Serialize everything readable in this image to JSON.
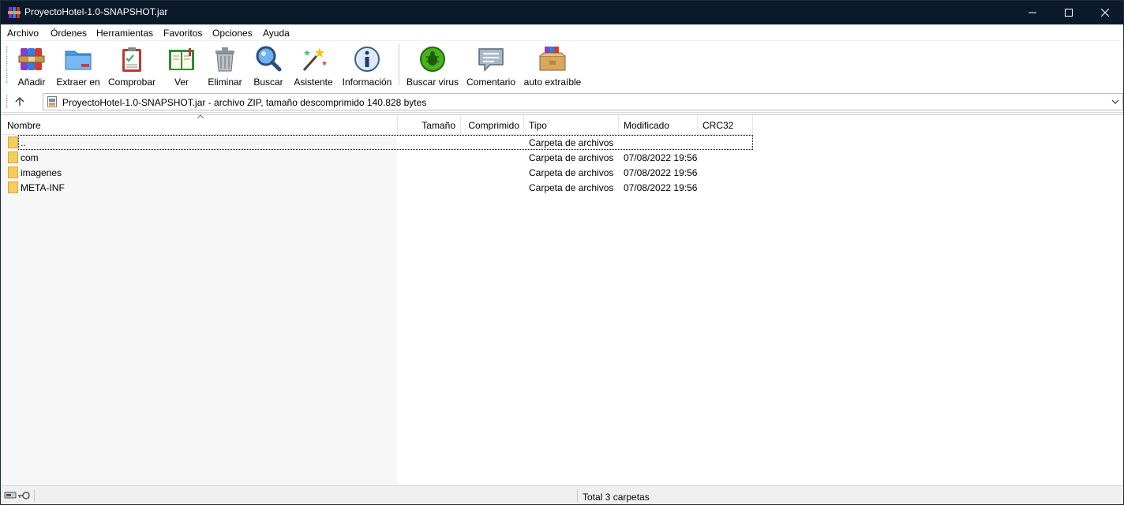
{
  "window": {
    "title": "ProyectoHotel-1.0-SNAPSHOT.jar"
  },
  "menu": [
    "Archivo",
    "Órdenes",
    "Herramientas",
    "Favoritos",
    "Opciones",
    "Ayuda"
  ],
  "toolbar": {
    "buttons": [
      {
        "label": "Añadir",
        "icon": "add-archive-icon"
      },
      {
        "label": "Extraer en",
        "icon": "extract-folder-icon"
      },
      {
        "label": "Comprobar",
        "icon": "test-clipboard-icon"
      },
      {
        "label": "Ver",
        "icon": "view-book-icon"
      },
      {
        "label": "Eliminar",
        "icon": "trash-icon"
      },
      {
        "label": "Buscar",
        "icon": "magnifier-icon"
      },
      {
        "label": "Asistente",
        "icon": "wizard-wand-icon"
      },
      {
        "label": "Información",
        "icon": "info-icon"
      },
      {
        "label": "Buscar virus",
        "icon": "virus-scan-icon"
      },
      {
        "label": "Comentario",
        "icon": "comment-icon"
      },
      {
        "label": "auto extraíble",
        "icon": "sfx-box-icon"
      }
    ]
  },
  "address": {
    "text": "ProyectoHotel-1.0-SNAPSHOT.jar - archivo ZIP, tamaño descomprimido 140.828 bytes"
  },
  "columns": {
    "name": "Nombre",
    "size": "Tamaño",
    "packed": "Comprimido",
    "type": "Tipo",
    "modified": "Modificado",
    "crc": "CRC32"
  },
  "files": [
    {
      "name": "..",
      "type": "Carpeta de archivos",
      "modified": ""
    },
    {
      "name": "com",
      "type": "Carpeta de archivos",
      "modified": "07/08/2022 19:56"
    },
    {
      "name": "imagenes",
      "type": "Carpeta de archivos",
      "modified": "07/08/2022 19:56"
    },
    {
      "name": "META-INF",
      "type": "Carpeta de archivos",
      "modified": "07/08/2022 19:56"
    }
  ],
  "status": {
    "text": "Total 3 carpetas"
  },
  "colors": {
    "titlebar": "#0b1a2b",
    "folder": "#f5cd5b",
    "virus": "#4caf1e"
  }
}
